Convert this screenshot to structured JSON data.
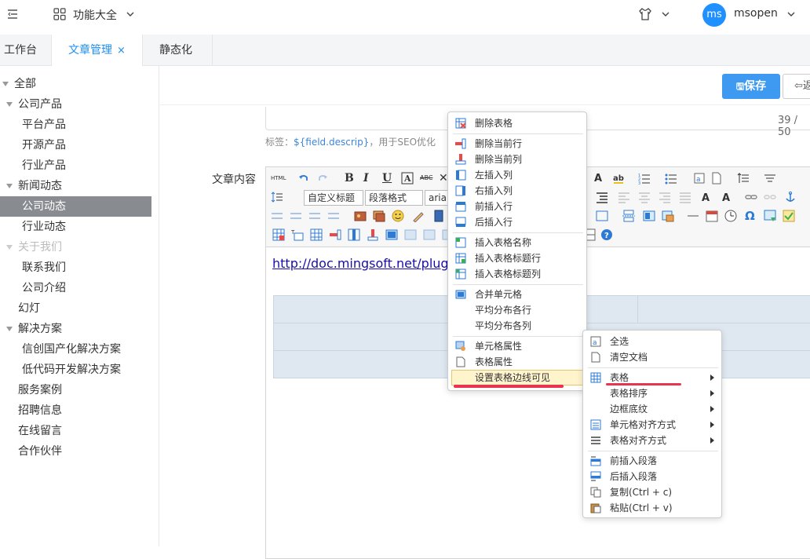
{
  "topbar": {
    "func_label": "功能大全",
    "avatar_initials": "ms",
    "user_name": "msopen"
  },
  "tabs": [
    {
      "label": "工作台"
    },
    {
      "label": "文章管理",
      "close": "×"
    },
    {
      "label": "静态化"
    }
  ],
  "sidebar": {
    "items": [
      {
        "label": "全部"
      },
      {
        "label": "公司产品"
      },
      {
        "label": "平台产品"
      },
      {
        "label": "开源产品"
      },
      {
        "label": "行业产品"
      },
      {
        "label": "新闻动态"
      },
      {
        "label": "公司动态"
      },
      {
        "label": "行业动态"
      },
      {
        "label": "关于我们"
      },
      {
        "label": "联系我们"
      },
      {
        "label": "公司介绍"
      },
      {
        "label": "幻灯"
      },
      {
        "label": "解决方案"
      },
      {
        "label": "信创国产化解决方案"
      },
      {
        "label": "低代码开发解决方案"
      },
      {
        "label": "服务案例"
      },
      {
        "label": "招聘信息"
      },
      {
        "label": "在线留言"
      },
      {
        "label": "合作伙伴"
      }
    ]
  },
  "actions": {
    "save_label": "保存",
    "back_label": "返"
  },
  "form": {
    "counter": "39 / 50",
    "hint_prefix": "标签：",
    "hint_code": "${field.descrip}",
    "hint_suffix": "，用于SEO优化",
    "content_label": "文章内容"
  },
  "editor": {
    "html_label": "HTML",
    "bold": "B",
    "italic": "I",
    "underline": "U",
    "strike": "ABC",
    "custom_title": "自定义标题",
    "paragraph_format": "段落格式",
    "font_family": "arial",
    "link_text": "http://doc.mingsoft.net/plugs"
  },
  "table_menu": {
    "items": [
      {
        "label": "删除表格"
      },
      {
        "label": "删除当前行"
      },
      {
        "label": "删除当前列"
      },
      {
        "label": "左插入列"
      },
      {
        "label": "右插入列"
      },
      {
        "label": "前插入行"
      },
      {
        "label": "后插入行"
      },
      {
        "label": "插入表格名称"
      },
      {
        "label": "插入表格标题行"
      },
      {
        "label": "插入表格标题列"
      },
      {
        "label": "合并单元格"
      },
      {
        "label": "平均分布各行"
      },
      {
        "label": "平均分布各列"
      },
      {
        "label": "单元格属性"
      },
      {
        "label": "表格属性"
      },
      {
        "label": "设置表格边线可见"
      }
    ]
  },
  "context_menu": {
    "items": [
      {
        "label": "全选"
      },
      {
        "label": "清空文档"
      },
      {
        "label": "表格"
      },
      {
        "label": "表格排序"
      },
      {
        "label": "边框底纹"
      },
      {
        "label": "单元格对齐方式"
      },
      {
        "label": "表格对齐方式"
      },
      {
        "label": "前插入段落"
      },
      {
        "label": "后插入段落"
      },
      {
        "label": "复制(Ctrl + c)"
      },
      {
        "label": "粘贴(Ctrl + v)"
      }
    ]
  },
  "colors": {
    "accent": "#1e8ff0",
    "save_button": "#3d9af0",
    "selected_bg": "#888b90",
    "highlight_mark": "#e8344c"
  }
}
